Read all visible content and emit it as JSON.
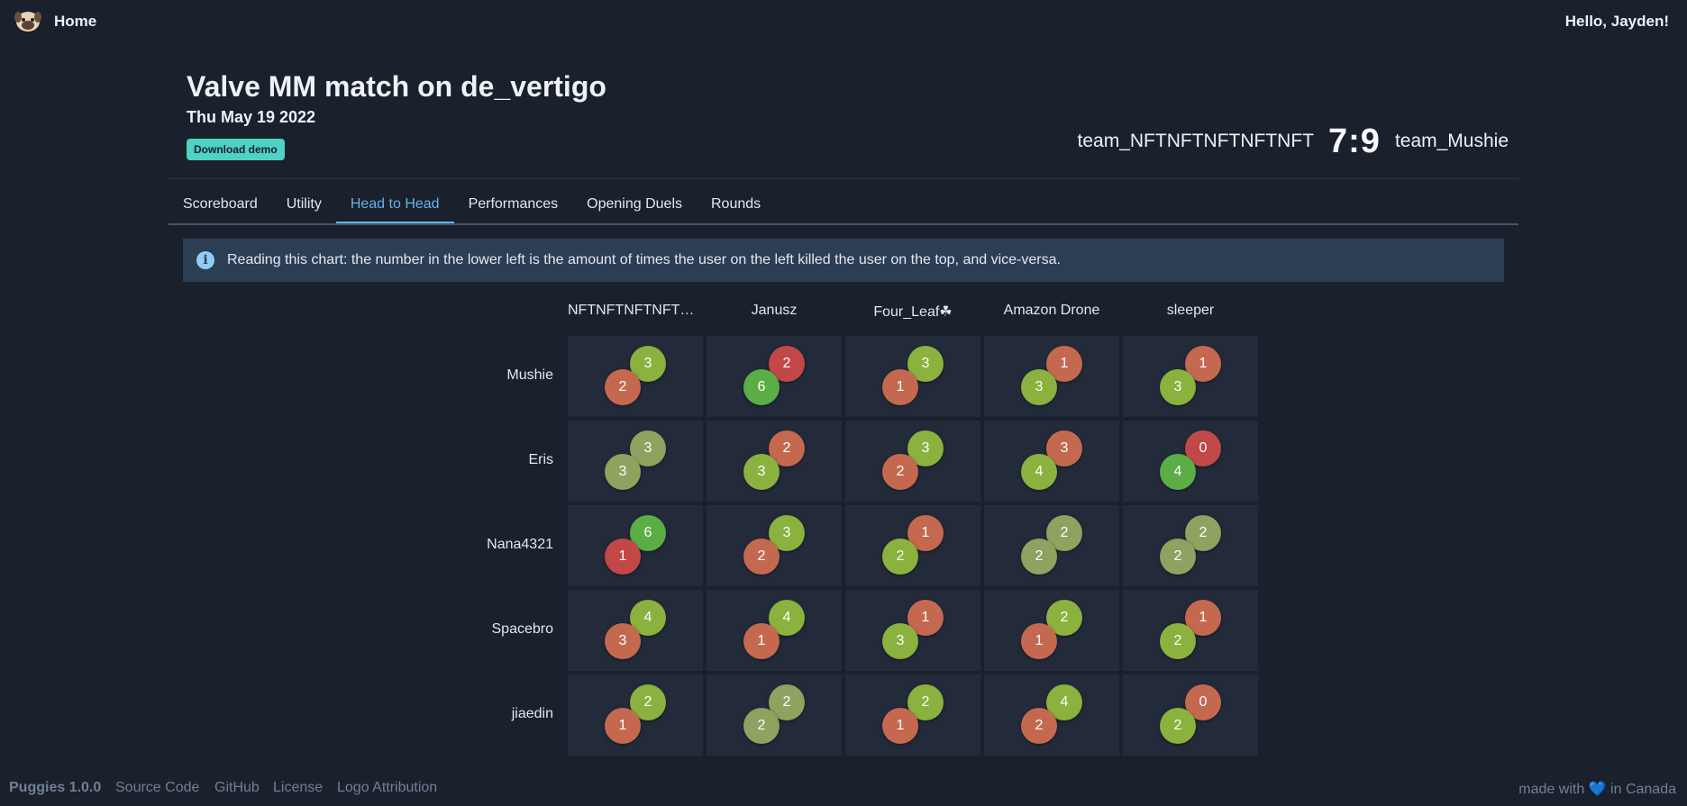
{
  "nav": {
    "home_label": "Home",
    "greeting": "Hello, Jayden!",
    "logo_icon": "pug-logo"
  },
  "match": {
    "title": "Valve MM match on de_vertigo",
    "date": "Thu May 19 2022",
    "download_label": "Download demo",
    "team_left": "team_NFTNFTNFTNFTNFT",
    "score_left": "7",
    "score_sep": ":",
    "score_right": "9",
    "team_right": "team_Mushie"
  },
  "tabs": [
    {
      "label": "Scoreboard",
      "active": false
    },
    {
      "label": "Utility",
      "active": false
    },
    {
      "label": "Head to Head",
      "active": true
    },
    {
      "label": "Performances",
      "active": false
    },
    {
      "label": "Opening Duels",
      "active": false
    },
    {
      "label": "Rounds",
      "active": false
    }
  ],
  "info": {
    "icon": "info-icon",
    "text": "Reading this chart: the number in the lower left is the amount of times the user on the left killed the user on the top, and vice-versa."
  },
  "h2h": {
    "columns": [
      "NFTNFTNFTNFTNFT",
      "Janusz",
      "Four_Leaf☘",
      "Amazon Drone",
      "sleeper"
    ],
    "rows": [
      {
        "name": "Mushie",
        "cells": [
          [
            3,
            2
          ],
          [
            2,
            6
          ],
          [
            3,
            1
          ],
          [
            1,
            3
          ],
          [
            1,
            3
          ]
        ]
      },
      {
        "name": "Eris",
        "cells": [
          [
            3,
            3
          ],
          [
            2,
            3
          ],
          [
            3,
            2
          ],
          [
            3,
            4
          ],
          [
            0,
            4
          ]
        ]
      },
      {
        "name": "Nana4321",
        "cells": [
          [
            6,
            1
          ],
          [
            3,
            2
          ],
          [
            1,
            2
          ],
          [
            2,
            2
          ],
          [
            2,
            2
          ]
        ]
      },
      {
        "name": "Spacebro",
        "cells": [
          [
            4,
            3
          ],
          [
            4,
            1
          ],
          [
            1,
            3
          ],
          [
            2,
            1
          ],
          [
            1,
            2
          ]
        ]
      },
      {
        "name": "jiaedin",
        "cells": [
          [
            2,
            1
          ],
          [
            2,
            2
          ],
          [
            2,
            1
          ],
          [
            4,
            2
          ],
          [
            0,
            2
          ]
        ]
      }
    ],
    "colors": {
      "top_win": "#8bb13e",
      "top_loss": "#c4694f",
      "bottom_win": "#8bb13e",
      "bottom_loss": "#c4694f",
      "tie": "#8fa25f",
      "strong_win": "#5aae45",
      "strong_loss": "#c24848"
    }
  },
  "footer": {
    "brand": "Puggies 1.0.0",
    "links": [
      "Source Code",
      "GitHub",
      "License",
      "Logo Attribution"
    ],
    "made_prefix": "made with",
    "heart": "💙",
    "made_suffix": "in Canada"
  }
}
